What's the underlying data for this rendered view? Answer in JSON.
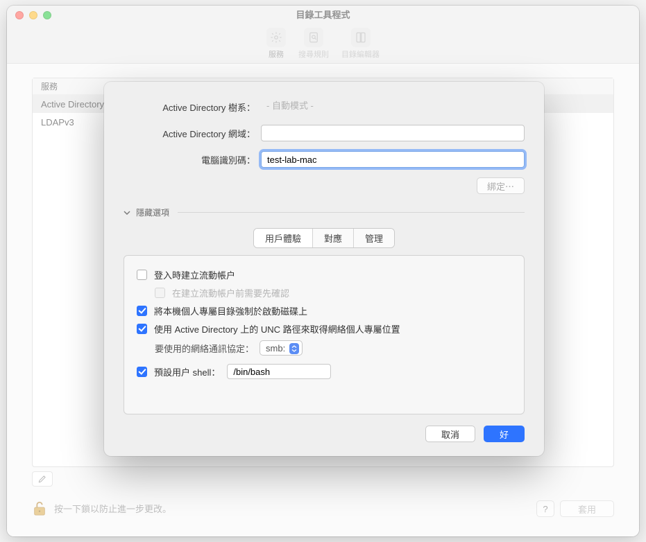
{
  "window": {
    "title": "目錄工具程式",
    "toolbar": [
      {
        "label": "服務",
        "icon": "gear",
        "active": true
      },
      {
        "label": "搜尋規則",
        "icon": "search-doc",
        "active": false
      },
      {
        "label": "目錄編輯器",
        "icon": "book",
        "active": false
      }
    ]
  },
  "services": {
    "header": "服務",
    "rows": [
      "Active Directory",
      "LDAPv3"
    ],
    "selected_index": 0
  },
  "lock": {
    "text": "按一下鎖以防止進一步更改。"
  },
  "footer": {
    "help": "?",
    "apply": "套用"
  },
  "sheet": {
    "forest_label": "Active Directory 樹系：",
    "forest_value": "- 自動模式 -",
    "domain_label": "Active Directory 網域：",
    "domain_value": "",
    "computer_id_label": "電腦識別碼：",
    "computer_id_value": "test-lab-mac",
    "bind_button": "綁定⋯",
    "disclosure_label": "隱藏選項",
    "tabs": [
      "用戶體驗",
      "對應",
      "管理"
    ],
    "active_tab": 0,
    "ux": {
      "create_mobile": {
        "checked": false,
        "label": "登入時建立流動帳户"
      },
      "confirm_mobile": {
        "checked": false,
        "disabled": true,
        "label": "在建立流動帳户前需要先確認"
      },
      "force_local_home": {
        "checked": true,
        "label": "將本機個人專屬目錄強制於啟動磁碟上"
      },
      "use_unc": {
        "checked": true,
        "label": "使用 Active Directory 上的 UNC 路徑來取得網絡個人專屬位置"
      },
      "protocol_label": "要使用的網絡通訊協定：",
      "protocol_value": "smb:",
      "default_shell": {
        "checked": true,
        "label": "預設用户 shell：",
        "value": "/bin/bash"
      }
    },
    "cancel": "取消",
    "ok": "好"
  }
}
